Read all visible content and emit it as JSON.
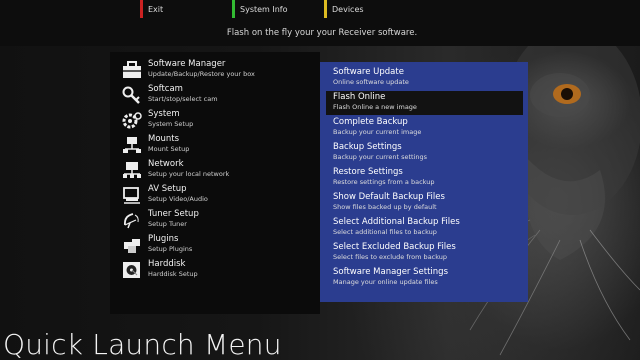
{
  "topbar": {
    "keys": [
      {
        "label": "Exit",
        "color": "#cc2222"
      },
      {
        "label": "System Info",
        "color": "#33bb33"
      },
      {
        "label": "Devices",
        "color": "#ddbb22"
      }
    ],
    "subtitle": "Flash on the fly your your Receiver software."
  },
  "left_menu": {
    "items": [
      {
        "title": "Software Manager",
        "desc": "Update/Backup/Restore your box",
        "icon": "software-manager-icon"
      },
      {
        "title": "Softcam",
        "desc": "Start/stop/select cam",
        "icon": "key-icon"
      },
      {
        "title": "System",
        "desc": "System Setup",
        "icon": "gear-icon"
      },
      {
        "title": "Mounts",
        "desc": "Mount Setup",
        "icon": "network-mount-icon"
      },
      {
        "title": "Network",
        "desc": "Setup your local network",
        "icon": "network-icon"
      },
      {
        "title": "AV Setup",
        "desc": "Setup Video/Audio",
        "icon": "monitor-icon"
      },
      {
        "title": "Tuner Setup",
        "desc": "Setup Tuner",
        "icon": "satellite-icon"
      },
      {
        "title": "Plugins",
        "desc": "Setup Plugins",
        "icon": "plugins-icon"
      },
      {
        "title": "Harddisk",
        "desc": "Harddisk Setup",
        "icon": "harddisk-icon"
      }
    ]
  },
  "right_menu": {
    "selected_index": 1,
    "items": [
      {
        "title": "Software Update",
        "desc": "Online software update"
      },
      {
        "title": "Flash Online",
        "desc": "Flash Online a new image"
      },
      {
        "title": "Complete Backup",
        "desc": "Backup your current image"
      },
      {
        "title": "Backup Settings",
        "desc": "Backup your current settings"
      },
      {
        "title": "Restore Settings",
        "desc": "Restore settings from a backup"
      },
      {
        "title": "Show Default Backup Files",
        "desc": "Show files backed up by default"
      },
      {
        "title": "Select Additional Backup Files",
        "desc": "Select additional files to backup"
      },
      {
        "title": "Select Excluded Backup Files",
        "desc": "Select files to exclude from backup"
      },
      {
        "title": "Software Manager Settings",
        "desc": "Manage your online update files"
      }
    ]
  },
  "footer": {
    "title": "Quick Launch Menu"
  }
}
